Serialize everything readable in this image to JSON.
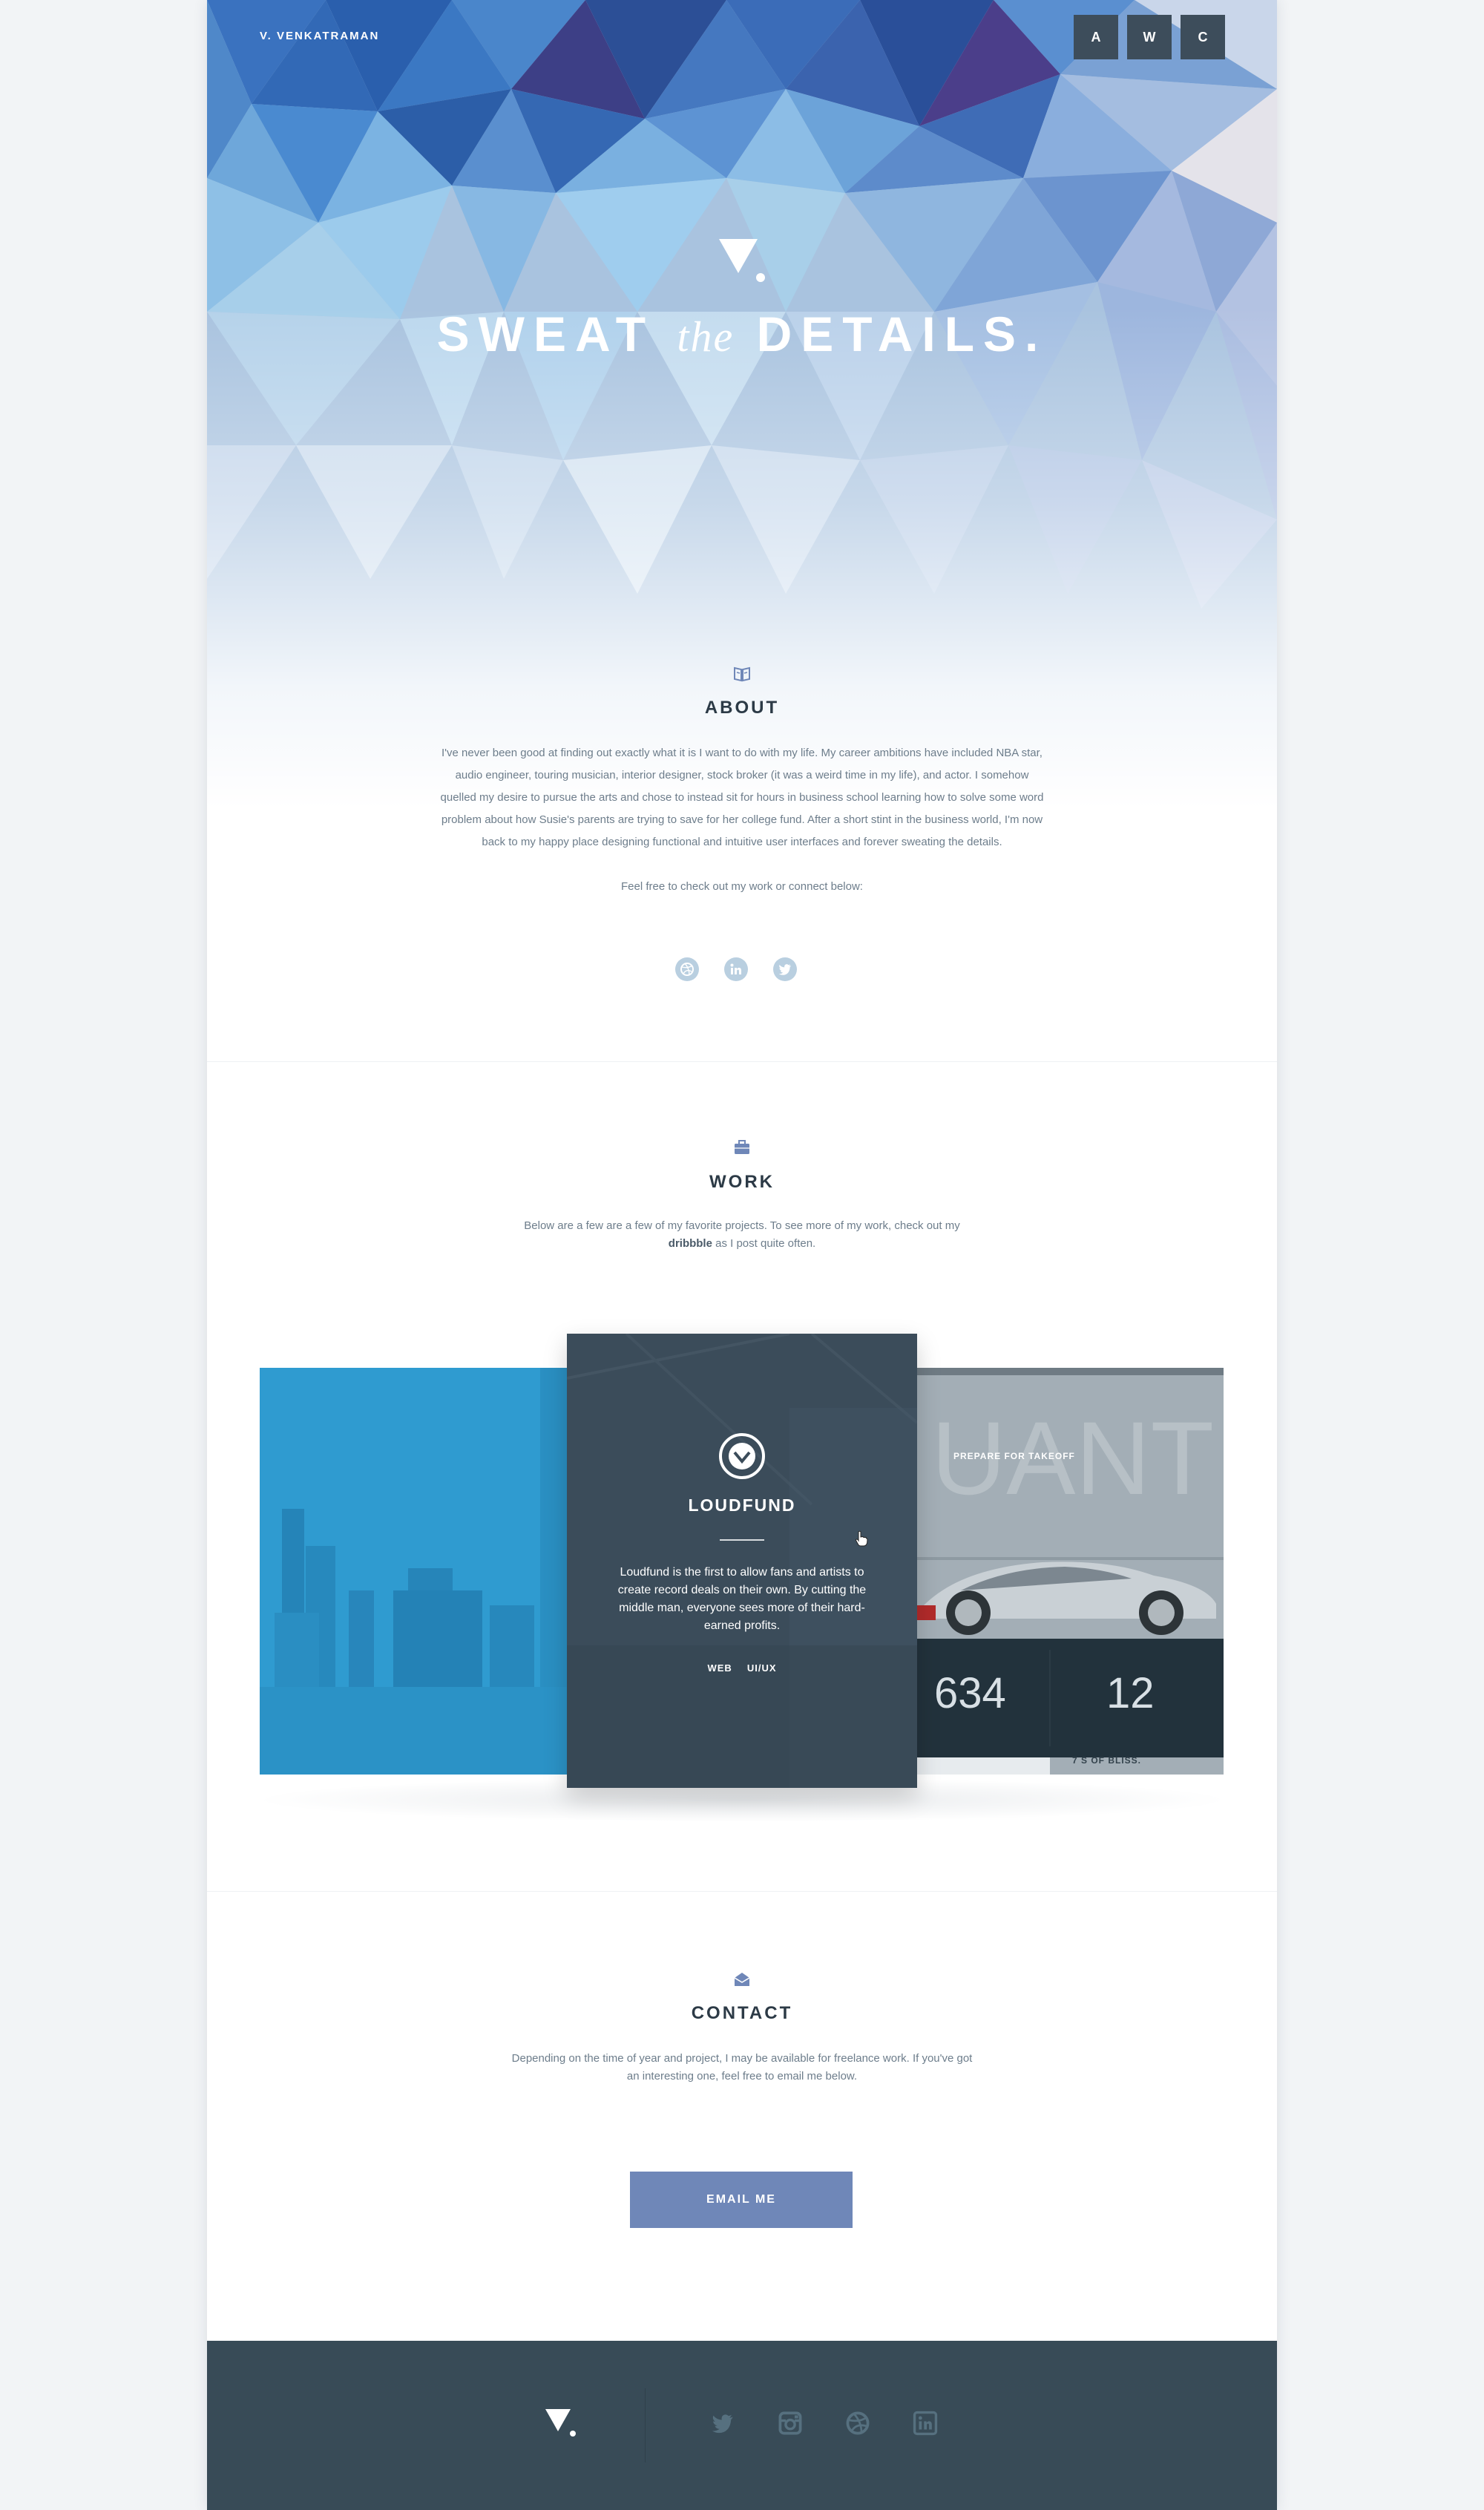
{
  "header": {
    "brand": "V. VENKATRAMAN",
    "nav": [
      "A",
      "W",
      "C"
    ]
  },
  "hero": {
    "tagline_part1": "SWEAT ",
    "tagline_the": "the",
    "tagline_part2": " DETAILS."
  },
  "about": {
    "icon": "book-icon",
    "title": "ABOUT",
    "lines": [
      "I've never been good at finding out exactly what it is I want to do with my life. My career ambitions have included NBA star,",
      "audio engineer, touring musician, interior designer, stock broker (it was a weird time in my life), and actor. I somehow",
      "quelled my desire to pursue the arts and chose to instead sit for hours in business school learning how to solve some word",
      "problem about how Susie's parents are trying to save for her college fund. After a short stint in the business world, I'm now",
      "back to my happy place designing functional and intuitive user interfaces and forever sweating the details."
    ],
    "cta": "Feel free to check out my work or connect below:",
    "socials": [
      "dribbble-icon",
      "linkedin-icon",
      "twitter-icon"
    ]
  },
  "work": {
    "icon": "briefcase-icon",
    "title": "WORK",
    "line1": "Below are a few are a few of my favorite projects. To see more of my work, check out my",
    "link": "dribbble",
    "line2_rest": " as I post quite often.",
    "featured": {
      "title": "LOUDFUND",
      "description": "Loudfund is the first to allow fans and artists to create record deals on their own. By cutting the middle man, everyone sees more of their hard-earned profits.",
      "tags": [
        "WEB",
        "UI/UX"
      ]
    },
    "right_card": {
      "heading": "PREPARE FOR TAKEOFF",
      "stat1": "634",
      "stat2": "12",
      "bottom": "7 S OF BLISS."
    }
  },
  "contact": {
    "icon": "envelope-icon",
    "title": "CONTACT",
    "line1": "Depending on the time of year and project, I may be available for freelance work. If you've got",
    "line2": "an interesting one, feel free to email me below.",
    "button": "EMAIL ME"
  },
  "footer": {
    "icons": [
      "twitter-icon",
      "instagram-icon",
      "dribbble-icon",
      "linkedin-icon"
    ]
  },
  "colors": {
    "accent": "#6f87b8",
    "footer_bg": "#384b57",
    "dark_text": "#2c3a46",
    "card_blue": "#2f9bd0"
  }
}
